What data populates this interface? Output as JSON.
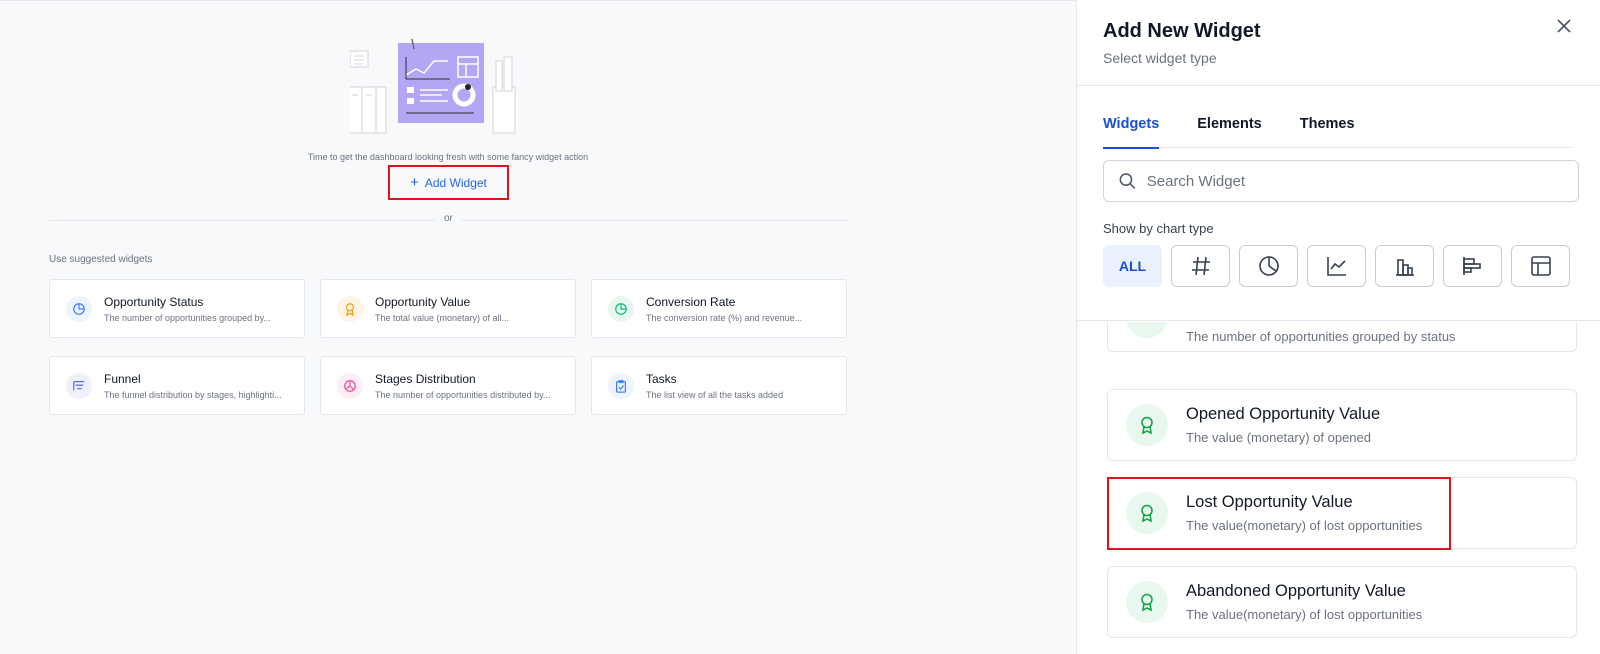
{
  "main": {
    "empty_text": "Time to get the dashboard looking fresh with some fancy widget action",
    "add_widget_label": "Add Widget",
    "or_text": "or",
    "suggested_label": "Use suggested widgets",
    "cards": [
      {
        "title": "Opportunity Status",
        "desc": "The number of opportunities grouped by...",
        "icon": "pie-chart-icon",
        "color": "#3b82f6",
        "bg": "#eef3fe"
      },
      {
        "title": "Opportunity Value",
        "desc": "The total value (monetary) of all...",
        "icon": "award-icon",
        "color": "#f59e0b",
        "bg": "#fef5e7"
      },
      {
        "title": "Conversion Rate",
        "desc": "The conversion rate (%) and revenue...",
        "icon": "pie-chart-icon",
        "color": "#10b981",
        "bg": "#e8f8ef"
      },
      {
        "title": "Funnel",
        "desc": "The funnel distribution by stages, highlighti...",
        "icon": "funnel-icon",
        "color": "#6366f1",
        "bg": "#eef0fe"
      },
      {
        "title": "Stages Distribution",
        "desc": "The number of opportunities distributed by...",
        "icon": "donut-icon",
        "color": "#ec4899",
        "bg": "#fdeef6"
      },
      {
        "title": "Tasks",
        "desc": "The list view of all the tasks added",
        "icon": "clipboard-check-icon",
        "color": "#3b82f6",
        "bg": "#eef3fe"
      }
    ]
  },
  "panel": {
    "title": "Add New Widget",
    "subtitle": "Select widget type",
    "tabs": [
      "Widgets",
      "Elements",
      "Themes"
    ],
    "search_placeholder": "Search Widget",
    "chart_type_label": "Show by chart type",
    "chart_types": [
      {
        "label": "ALL",
        "icon": ""
      },
      {
        "label": "",
        "icon": "hash-icon"
      },
      {
        "label": "",
        "icon": "pie-chart-icon"
      },
      {
        "label": "",
        "icon": "line-chart-icon"
      },
      {
        "label": "",
        "icon": "bar-chart-icon"
      },
      {
        "label": "",
        "icon": "horizontal-bar-icon"
      },
      {
        "label": "",
        "icon": "table-icon"
      }
    ],
    "widgets": [
      {
        "title": "",
        "desc": "The number of opportunities grouped by status"
      },
      {
        "title": "Opened Opportunity Value",
        "desc": "The value (monetary) of opened"
      },
      {
        "title": "Lost Opportunity Value",
        "desc": "The value(monetary) of lost opportunities"
      },
      {
        "title": "Abandoned Opportunity Value",
        "desc": "The value(monetary) of lost opportunities"
      }
    ],
    "accent_color": "#1d4ed8",
    "highlight_color": "#e0131c"
  }
}
